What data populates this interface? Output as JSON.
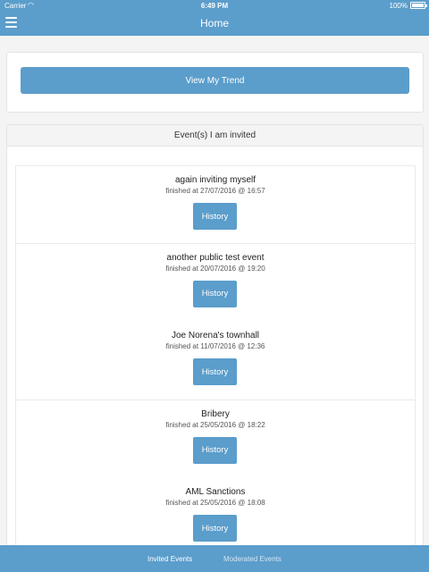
{
  "status_bar": {
    "carrier": "Carrier",
    "time": "6:49 PM",
    "battery": "100%"
  },
  "header": {
    "title": "Home",
    "menu_icon": "hamburger-menu-icon"
  },
  "trend": {
    "button_label": "View My Trend"
  },
  "events": {
    "header": "Event(s) I am invited",
    "history_label": "History",
    "items": [
      {
        "name": "again inviting myself",
        "time": "finished at 27/07/2016 @ 16:57"
      },
      {
        "name": "another public test event",
        "time": "finished at 20/07/2016 @ 19:20"
      },
      {
        "name": "Joe Norena's townhall",
        "time": "finished at 11/07/2016 @ 12:36"
      },
      {
        "name": "Bribery",
        "time": "finished at 25/05/2016 @ 18:22"
      },
      {
        "name": "AML Sanctions",
        "time": "finished at 25/05/2016 @ 18:08"
      }
    ]
  },
  "tabs": [
    {
      "label": "Invited Events",
      "active": true
    },
    {
      "label": "Moderated Events",
      "active": false
    }
  ],
  "colors": {
    "accent": "#5b9dcb",
    "background": "#f4f4f4"
  }
}
